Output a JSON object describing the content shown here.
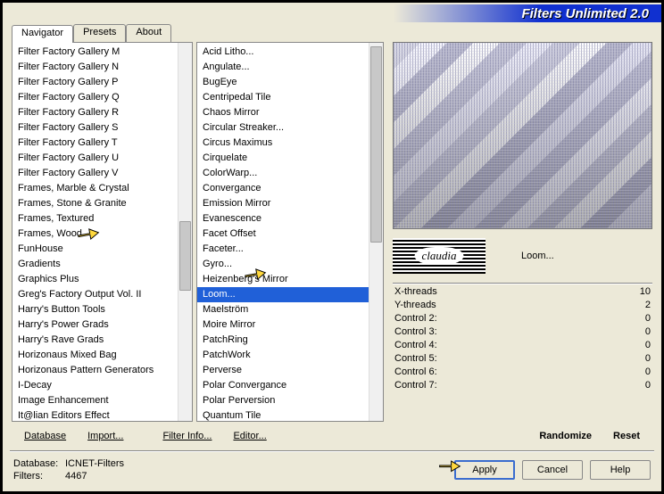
{
  "app": {
    "title": "Filters Unlimited 2.0"
  },
  "tabs": [
    {
      "label": "Navigator"
    },
    {
      "label": "Presets"
    },
    {
      "label": "About"
    }
  ],
  "left_list": [
    "Filter Factory Gallery M",
    "Filter Factory Gallery N",
    "Filter Factory Gallery P",
    "Filter Factory Gallery Q",
    "Filter Factory Gallery R",
    "Filter Factory Gallery S",
    "Filter Factory Gallery T",
    "Filter Factory Gallery U",
    "Filter Factory Gallery V",
    "Frames, Marble & Crystal",
    "Frames, Stone & Granite",
    "Frames, Textured",
    "Frames, Wood",
    "FunHouse",
    "Gradients",
    "Graphics Plus",
    "Greg's Factory Output Vol. II",
    "Harry's Button Tools",
    "Harry's Power Grads",
    "Harry's Rave Grads",
    "Horizonaus Mixed Bag",
    "Horizonaus Pattern Generators",
    "I-Decay",
    "Image Enhancement",
    "It@lian Editors Effect"
  ],
  "left_selected": "FunHouse",
  "mid_list": [
    "Acid Litho...",
    "Angulate...",
    "BugEye",
    "Centripedal Tile",
    "Chaos Mirror",
    "Circular Streaker...",
    "Circus Maximus",
    "Cirquelate",
    "ColorWarp...",
    "Convergance",
    "Emission Mirror",
    "Evanescence",
    "Facet Offset",
    "Faceter...",
    "Gyro...",
    "Heizenberg's Mirror",
    "Loom...",
    "Maelström",
    "Moire Mirror",
    "PatchRing",
    "PatchWork",
    "Perverse",
    "Polar Convergance",
    "Polar Perversion",
    "Quantum Tile"
  ],
  "mid_selected": "Loom...",
  "logo_label": "claudia",
  "filter_name": "Loom...",
  "params": [
    {
      "label": "X-threads",
      "value": "10"
    },
    {
      "label": "Y-threads",
      "value": "2"
    },
    {
      "label": "Control 2:",
      "value": "0"
    },
    {
      "label": "Control 3:",
      "value": "0"
    },
    {
      "label": "Control 4:",
      "value": "0"
    },
    {
      "label": "Control 5:",
      "value": "0"
    },
    {
      "label": "Control 6:",
      "value": "0"
    },
    {
      "label": "Control 7:",
      "value": "0"
    }
  ],
  "link_buttons": {
    "database": "Database",
    "import": "Import...",
    "filter_info": "Filter Info...",
    "editor": "Editor...",
    "randomize": "Randomize",
    "reset": "Reset"
  },
  "status": {
    "db_label": "Database:",
    "db_value": "ICNET-Filters",
    "filters_label": "Filters:",
    "filters_value": "4467"
  },
  "buttons": {
    "apply": "Apply",
    "cancel": "Cancel",
    "help": "Help"
  }
}
